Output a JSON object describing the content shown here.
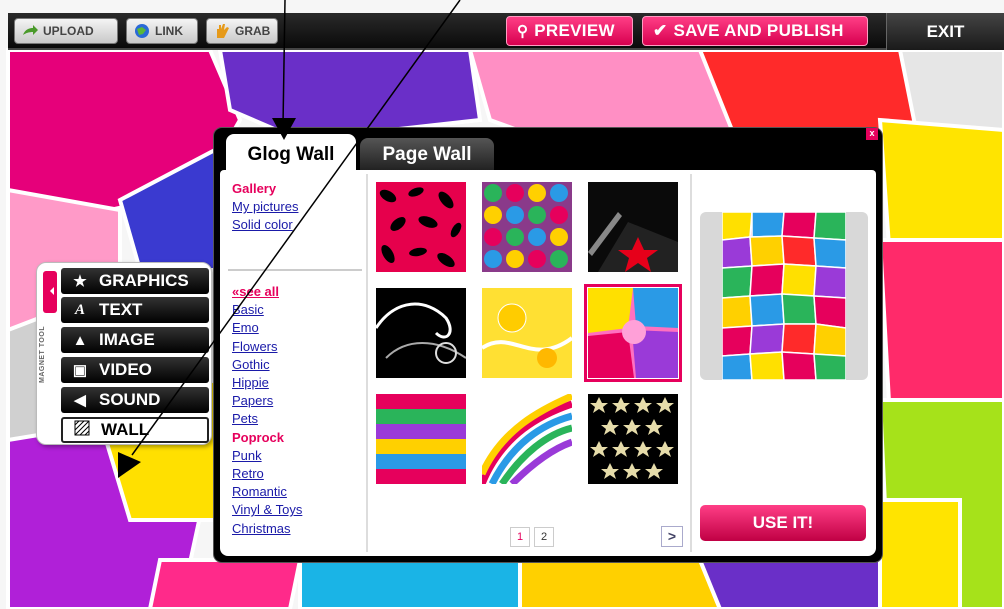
{
  "toolbar": {
    "upload": "UPLOAD",
    "link": "LINK",
    "grab": "GRAB",
    "preview": "PREVIEW",
    "save_publish": "SAVE AND PUBLISH",
    "exit": "EXIT"
  },
  "side_panel": {
    "vertical_label": "MAGNET TOOL",
    "tools": [
      {
        "label": "GRAPHICS",
        "icon": "star-icon"
      },
      {
        "label": "TEXT",
        "icon": "italic-a-icon"
      },
      {
        "label": "IMAGE",
        "icon": "image-icon"
      },
      {
        "label": "VIDEO",
        "icon": "film-icon"
      },
      {
        "label": "SOUND",
        "icon": "speaker-icon"
      },
      {
        "label": "WALL",
        "icon": "hatched-wall-icon"
      }
    ],
    "active_tool": "WALL"
  },
  "modal": {
    "tabs": [
      "Glog Wall",
      "Page Wall"
    ],
    "active_tab": "Glog Wall",
    "top_links": [
      "Gallery",
      "My pictures",
      "Solid color"
    ],
    "selected_top": "Gallery",
    "categories": [
      "«see all",
      "Basic",
      "Emo",
      "Flowers",
      "Gothic",
      "Hippie",
      "Papers",
      "Pets",
      "Poprock",
      "Punk",
      "Retro",
      "Romantic",
      "Vinyl & Toys",
      "Christmas"
    ],
    "selected_category": "Poprock",
    "pages": [
      "1",
      "2"
    ],
    "current_page": "1",
    "next": ">",
    "use_it": "USE IT!",
    "close": "x",
    "selected_thumbnail": 5
  },
  "colors": {
    "accent": "#e6005c",
    "toolbar_bg": "#111111",
    "link": "#1a1aa8"
  }
}
